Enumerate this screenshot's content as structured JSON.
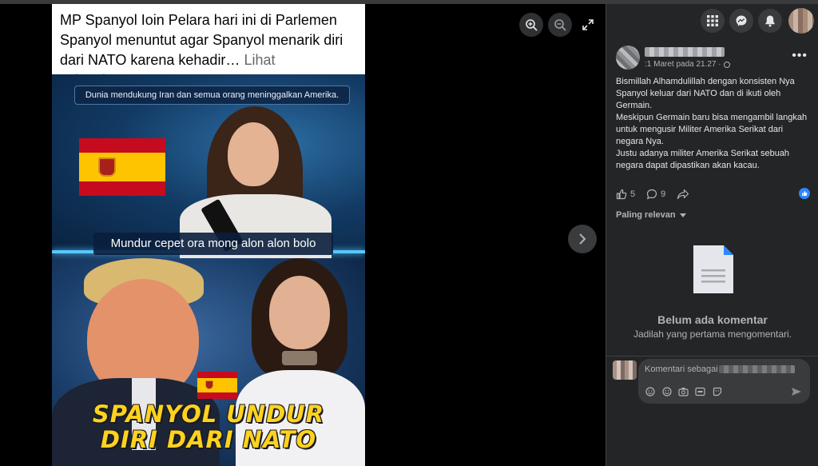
{
  "post": {
    "caption": "MP Spanyol Ioin Pelara hari ini di Parlemen Spanyol menuntut agar Spanyol menarik diri dari NATO karena kehadir…",
    "see_more": "Lihat selengkapnya",
    "image": {
      "top_banner": "Dunia mendukung Iran dan semua orang meninggalkan Amerika.",
      "middle_caption": "Mundur cepet ora mong alon alon bolo",
      "title_line1": "SPANYOL UNDUR",
      "title_line2": "DIRI DARI NATO"
    }
  },
  "viewer_controls": {
    "zoom_in_icon": "zoom-in-icon",
    "zoom_out_icon": "zoom-out-icon",
    "fullscreen_icon": "fullscreen-icon",
    "next_icon": "chevron-right-icon"
  },
  "side": {
    "header_icons": [
      "grid-menu-icon",
      "messenger-icon",
      "bell-icon"
    ],
    "author": {
      "time": ":1 Maret pada 21.27 ·"
    },
    "text": [
      "Bismillah Alhamdulillah dengan konsisten Nya Spanyol keluar dari NATO dan di ikuti oleh Germain.",
      "Meskipun Germain baru bisa mengambil langkah untuk mengusir Militer Amerika Serikat dari negara Nya.",
      "Justu adanya militer Amerika Serikat sebuah negara dapat dipastikan akan kacau."
    ],
    "reactions": {
      "likes": "5",
      "comments": "9"
    },
    "sort_label": "Paling relevan",
    "empty": {
      "title": "Belum ada komentar",
      "subtitle": "Jadilah yang pertama mengomentari."
    },
    "composer": {
      "placeholder": "Komentari sebagai"
    }
  },
  "colors": {
    "panel_bg": "#242526",
    "button_bg": "#3a3b3c",
    "text_primary": "#e4e6eb",
    "text_secondary": "#b0b3b8",
    "accent_blue": "#2d88ff",
    "title_yellow": "#ffd21f"
  }
}
